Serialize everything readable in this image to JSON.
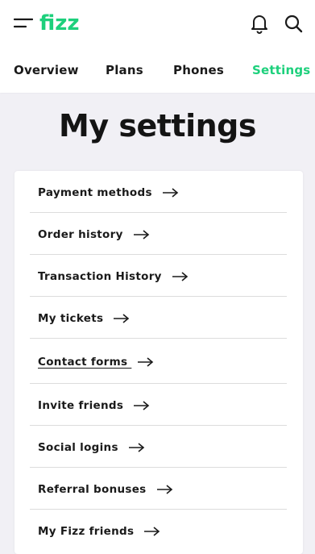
{
  "header": {
    "logo_text": "fizz",
    "brand_color": "#1dd07c",
    "icons": [
      "menu-icon",
      "bell-icon",
      "search-icon"
    ]
  },
  "tabs": [
    {
      "label": "Overview",
      "active": false
    },
    {
      "label": "Plans",
      "active": false
    },
    {
      "label": "Phones",
      "active": false
    },
    {
      "label": "Settings",
      "active": true
    }
  ],
  "main": {
    "title": "My settings",
    "items": [
      {
        "label": "Payment methods"
      },
      {
        "label": "Order history"
      },
      {
        "label": "Transaction History"
      },
      {
        "label": "My tickets"
      },
      {
        "label": "Contact forms "
      },
      {
        "label": "Invite friends"
      },
      {
        "label": "Social logins"
      },
      {
        "label": "Referral bonuses"
      },
      {
        "label": "My Fizz friends"
      }
    ]
  }
}
